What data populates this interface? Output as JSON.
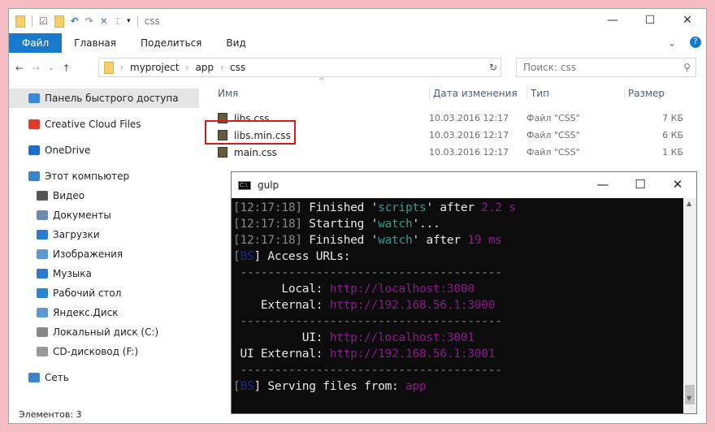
{
  "window": {
    "title": "css",
    "controls": [
      "minimize",
      "maximize",
      "close"
    ]
  },
  "ribbon": {
    "tabs": [
      "Файл",
      "Главная",
      "Поделиться",
      "Вид"
    ]
  },
  "address": {
    "path": [
      "myproject",
      "app",
      "css"
    ],
    "search_placeholder": "Поиск: css"
  },
  "sidebar": {
    "items": [
      {
        "label": "Панель быстрого доступа",
        "icon": "star-icon",
        "color": "#3b88d8"
      },
      {
        "label": "Creative Cloud Files",
        "icon": "creative-cloud-icon",
        "color": "#e03a2a"
      },
      {
        "label": "OneDrive",
        "icon": "cloud-icon",
        "color": "#1c6ed0"
      },
      {
        "label": "Этот компьютер",
        "icon": "computer-icon",
        "color": "#3a86c8"
      },
      {
        "label": "Видео",
        "icon": "video-icon",
        "color": "#555"
      },
      {
        "label": "Документы",
        "icon": "document-icon",
        "color": "#6a8ab0"
      },
      {
        "label": "Загрузки",
        "icon": "download-icon",
        "color": "#2a7ad0"
      },
      {
        "label": "Изображения",
        "icon": "pictures-icon",
        "color": "#5a9ad0"
      },
      {
        "label": "Музыка",
        "icon": "music-icon",
        "color": "#2a7ad0"
      },
      {
        "label": "Рабочий стол",
        "icon": "desktop-icon",
        "color": "#2a86d0"
      },
      {
        "label": "Яндекс.Диск",
        "icon": "yandex-disk-icon",
        "color": "#5a9ad0"
      },
      {
        "label": "Локальный диск (C:)",
        "icon": "drive-icon",
        "color": "#888"
      },
      {
        "label": "CD-дисковод (F:)",
        "icon": "cd-drive-icon",
        "color": "#999"
      },
      {
        "label": "Сеть",
        "icon": "network-icon",
        "color": "#3a86c8"
      }
    ]
  },
  "columns": [
    "Имя",
    "Дата изменения",
    "Тип",
    "Размер"
  ],
  "files": [
    {
      "name": "libs.css",
      "date": "10.03.2016 12:17",
      "type": "Файл \"CSS\"",
      "size": "7 КБ"
    },
    {
      "name": "libs.min.css",
      "date": "10.03.2016 12:17",
      "type": "Файл \"CSS\"",
      "size": "6 КБ"
    },
    {
      "name": "main.css",
      "date": "10.03.2016 12:17",
      "type": "Файл \"CSS\"",
      "size": "1 КБ"
    }
  ],
  "status": "Элементов: 3",
  "terminal": {
    "title": "gulp",
    "lines": [
      [
        [
          "[12:17:18]",
          "gr"
        ],
        [
          " Finished '",
          "wh"
        ],
        [
          "scripts",
          "cy"
        ],
        [
          "' after ",
          "wh"
        ],
        [
          "2.2 s",
          "mg"
        ]
      ],
      [
        [
          "[12:17:18]",
          "gr"
        ],
        [
          " Starting '",
          "wh"
        ],
        [
          "watch",
          "cy"
        ],
        [
          "'...",
          "wh"
        ]
      ],
      [
        [
          "[12:17:18]",
          "gr"
        ],
        [
          " Finished '",
          "wh"
        ],
        [
          "watch",
          "cy"
        ],
        [
          "' after ",
          "wh"
        ],
        [
          "19 ms",
          "mg"
        ]
      ],
      [
        [
          "[",
          "gr"
        ],
        [
          "BS",
          "bl"
        ],
        [
          "] Access URLs:",
          "wh"
        ]
      ],
      [
        [
          " --------------------------------------",
          "gr"
        ]
      ],
      [
        [
          "       Local: ",
          "wh"
        ],
        [
          "http://localhost:3000",
          "mg"
        ]
      ],
      [
        [
          "    External: ",
          "wh"
        ],
        [
          "http://192.168.56.1:3000",
          "mg"
        ]
      ],
      [
        [
          " --------------------------------------",
          "gr"
        ]
      ],
      [
        [
          "          UI: ",
          "wh"
        ],
        [
          "http://localhost:3001",
          "mg"
        ]
      ],
      [
        [
          " UI External: ",
          "wh"
        ],
        [
          "http://192.168.56.1:3001",
          "mg"
        ]
      ],
      [
        [
          " --------------------------------------",
          "gr"
        ]
      ],
      [
        [
          "[",
          "gr"
        ],
        [
          "BS",
          "bl"
        ],
        [
          "] Serving files from: ",
          "wh"
        ],
        [
          "app",
          "mg"
        ]
      ]
    ]
  }
}
